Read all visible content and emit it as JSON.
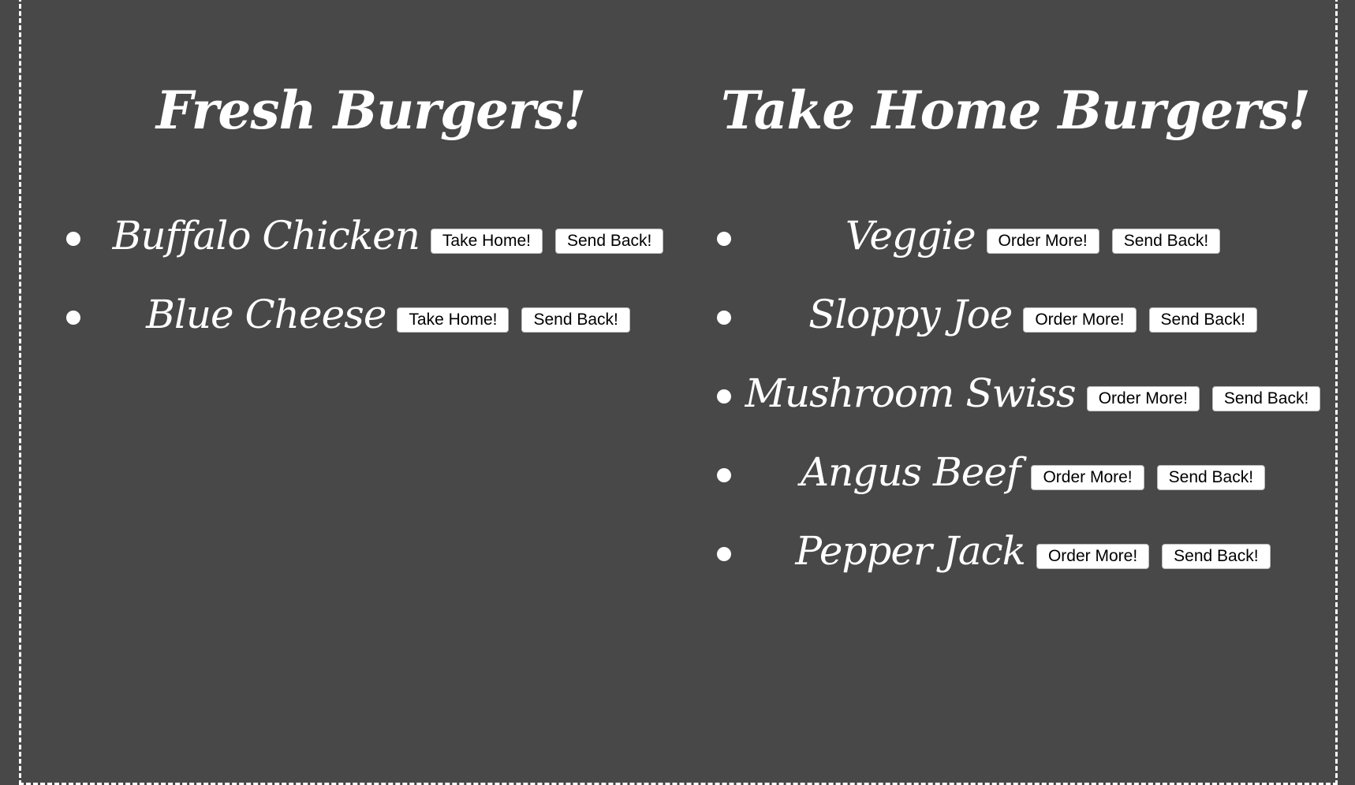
{
  "fresh": {
    "title": "Fresh Burgers!",
    "take_label": "Take Home!",
    "send_label": "Send Back!",
    "items": [
      "Buffalo Chicken",
      "Blue Cheese"
    ]
  },
  "take_home": {
    "title": "Take Home Burgers!",
    "order_label": "Order More!",
    "send_label": "Send Back!",
    "items": [
      "Veggie",
      "Sloppy Joe",
      "Mushroom Swiss",
      "Angus Beef",
      "Pepper Jack"
    ]
  },
  "colors": {
    "background": "#484848",
    "text": "#ffffff",
    "button_bg": "#ffffff"
  }
}
